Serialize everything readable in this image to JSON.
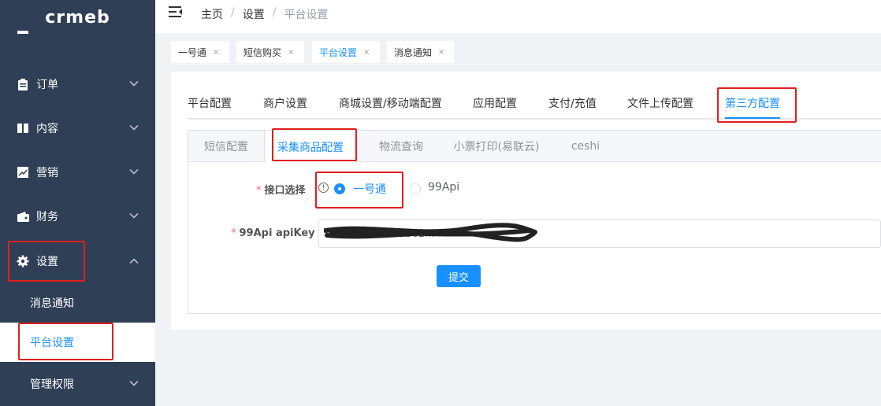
{
  "logo": "crmeb",
  "sidebar": {
    "menu": [
      {
        "label": "订单",
        "icon": "clipboard-icon"
      },
      {
        "label": "内容",
        "icon": "book-icon"
      },
      {
        "label": "营销",
        "icon": "chart-icon"
      },
      {
        "label": "财务",
        "icon": "wallet-icon"
      },
      {
        "label": "设置",
        "icon": "gear-icon"
      }
    ],
    "sub": [
      {
        "label": "消息通知"
      },
      {
        "label": "平台设置"
      }
    ],
    "last": {
      "label": "管理权限"
    }
  },
  "breadcrumb": [
    "主页",
    "设置",
    "平台设置"
  ],
  "tags": [
    "一号通",
    "短信购买",
    "平台设置",
    "消息通知"
  ],
  "tags_close": "×",
  "tabs": [
    "平台配置",
    "商户设置",
    "商城设置/移动端配置",
    "应用配置",
    "支付/充值",
    "文件上传配置",
    "第三方配置"
  ],
  "inner_tabs": [
    "短信配置",
    "采集商品配置",
    "物流查询",
    "小票打印(易联云)",
    "ceshi"
  ],
  "form": {
    "api_label": "接口选择",
    "required_mark": "*",
    "options": [
      "一号通",
      "99Api"
    ],
    "selected": "一号通",
    "key_label": "99Api apiKey",
    "key_value": "0DA0B2270BE2C2...",
    "submit": "提交"
  },
  "colors": {
    "sidebar_bg": "#2e3f56",
    "accent": "#1890ff",
    "highlight_box": "#e01f1f"
  }
}
